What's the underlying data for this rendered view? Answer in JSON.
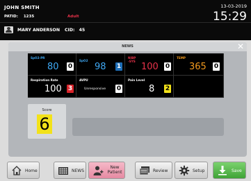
{
  "header": {
    "patient_name": "JOHN SMITH",
    "patid_label": "PATID:",
    "patid_value": "1235",
    "category": "Adult",
    "date": "13-03-2019",
    "time": "15:29",
    "user_name": "MARY ANDERSON",
    "cid_label": "CID:",
    "cid_value": "45",
    "icon": "user-icon"
  },
  "dialog": {
    "title": "NEWS",
    "close_icon": "close-icon"
  },
  "parameters": [
    {
      "label": "SpO2-PR",
      "value": "80",
      "score": "0",
      "score_color": "#ffffff",
      "label_color": "#3fa9f5",
      "value_color": "#3fa9f5"
    },
    {
      "label": "SpO2",
      "value": "98",
      "score": "1",
      "score_color": "#1f6fb8",
      "label_color": "#3fa9f5",
      "value_color": "#3fa9f5"
    },
    {
      "label": "NIBP\n-SYS",
      "value": "100",
      "score": "0",
      "score_color": "#ffffff",
      "label_color": "#e8324a",
      "value_color": "#e8324a"
    },
    {
      "label": "TEMP",
      "value": "365",
      "score": "0",
      "score_color": "#ffffff",
      "label_color": "#f39a1e",
      "value_color": "#f39a1e"
    },
    {
      "label": "Respiration Rate",
      "value": "100",
      "score": "3",
      "score_color": "#d8232a",
      "label_color": "#ffffff",
      "value_color": "#ffffff"
    },
    {
      "label": "AVPU",
      "value": "Unresponsive",
      "score": "0",
      "score_color": "#ffffff",
      "label_color": "#ffffff",
      "value_color": "#ffffff"
    },
    {
      "label": "Pain Level",
      "value": "8",
      "score": "2",
      "score_color": "#f2e21a",
      "label_color": "#ffffff",
      "value_color": "#ffffff"
    }
  ],
  "total": {
    "label": "Score",
    "value": "6",
    "color": "#f2e21a"
  },
  "toolbar": {
    "home": {
      "label": "Home",
      "icon": "home-icon"
    },
    "news": {
      "label": "NEWS",
      "icon": "keypad-icon"
    },
    "new_patient": {
      "label": "New\nPatient",
      "icon": "add-patient-icon"
    },
    "review": {
      "label": "Review",
      "icon": "review-icon"
    },
    "setup": {
      "label": "Setup",
      "icon": "gear-icon"
    },
    "save": {
      "label": "Save",
      "icon": "download-icon"
    }
  }
}
